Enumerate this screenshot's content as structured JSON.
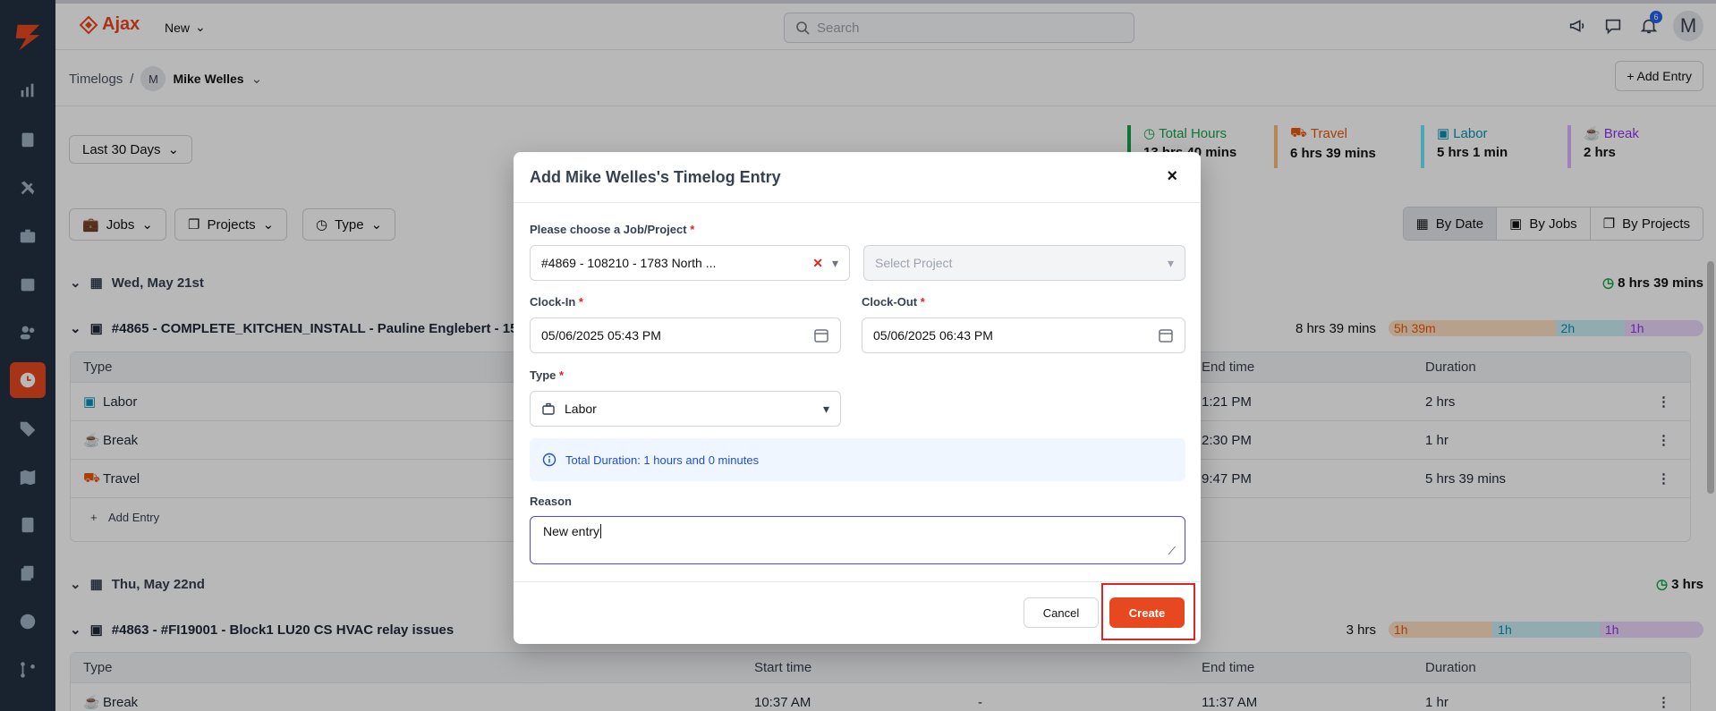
{
  "app": {
    "brand": "Ajax",
    "new_label": "New",
    "search_placeholder": "Search",
    "notifications_count": "6",
    "user_initial": "M"
  },
  "sidebar": {
    "items": [
      "dashboard",
      "reports",
      "documents",
      "tools",
      "inventory",
      "calendar",
      "users",
      "timelogs",
      "tags",
      "map",
      "calculator",
      "files",
      "analytics",
      "workflows"
    ],
    "active": "timelogs"
  },
  "breadcrumb": {
    "root": "Timelogs",
    "separator": "/",
    "avatar": "M",
    "user": "Mike Welles"
  },
  "toolbar": {
    "add_entry": "+ Add Entry",
    "range": "Last 30 Days",
    "filters": [
      "Jobs",
      "Projects",
      "Type"
    ],
    "views": [
      "By Date",
      "By Jobs",
      "By Projects"
    ]
  },
  "stats": [
    {
      "label": "Total Hours",
      "value": "13 hrs 40 mins",
      "color": "#16a34a"
    },
    {
      "label": "Travel",
      "value": "6 hrs 39 mins",
      "color": "#ea580c"
    },
    {
      "label": "Labor",
      "value": "5 hrs 1 min",
      "color": "#0891b2"
    },
    {
      "label": "Break",
      "value": "2 hrs",
      "color": "#9333ea"
    }
  ],
  "days": [
    {
      "date": "Wed, May 21st",
      "total": "8 hrs 39 mins",
      "job": "#4865 - COMPLETE_KITCHEN_INSTALL - Pauline Englebert - 1520",
      "job_total": "8 hrs 39 mins",
      "bar": [
        {
          "label": "5h 39m",
          "fraction": 0.53
        },
        {
          "label": "2h",
          "fraction": 0.22
        },
        {
          "label": "1h",
          "fraction": 0.25
        }
      ],
      "headers": {
        "type": "Type",
        "end": "End time",
        "duration": "Duration"
      },
      "rows": [
        {
          "type": "Labor",
          "end": "1:21 PM",
          "duration": "2 hrs"
        },
        {
          "type": "Break",
          "end": "2:30 PM",
          "duration": "1 hr"
        },
        {
          "type": "Travel",
          "end": "9:47 PM",
          "duration": "5 hrs 39 mins"
        }
      ],
      "add_entry": "Add Entry"
    },
    {
      "date": "Thu, May 22nd",
      "total": "3 hrs",
      "job": "#4863 - #FI19001 - Block1 LU20 CS HVAC relay issues",
      "job_total": "3 hrs",
      "bar": [
        {
          "label": "1h",
          "fraction": 0.33
        },
        {
          "label": "1h",
          "fraction": 0.34
        },
        {
          "label": "1h",
          "fraction": 0.33
        }
      ],
      "headers": {
        "type": "Type",
        "start": "Start time",
        "end": "End time",
        "duration": "Duration"
      },
      "rows": [
        {
          "type": "Break",
          "start": "10:37 AM",
          "dash": "-",
          "end": "11:37 AM",
          "duration": "1 hr"
        }
      ]
    }
  ],
  "modal": {
    "title": "Add Mike Welles's Timelog Entry",
    "close": "×",
    "job_label": "Please choose a Job/Project",
    "job_value": "#4869 - 108210 - 1783 North ...",
    "project_placeholder": "Select Project",
    "clock_in_label": "Clock-In",
    "clock_in_value": "05/06/2025 05:43 PM",
    "clock_out_label": "Clock-Out",
    "clock_out_value": "05/06/2025 06:43 PM",
    "type_label": "Type",
    "type_value": "Labor",
    "info": "Total Duration: 1 hours and 0 minutes",
    "reason_label": "Reason",
    "reason_value": "New entry",
    "cancel": "Cancel",
    "create": "Create",
    "required": "*"
  }
}
